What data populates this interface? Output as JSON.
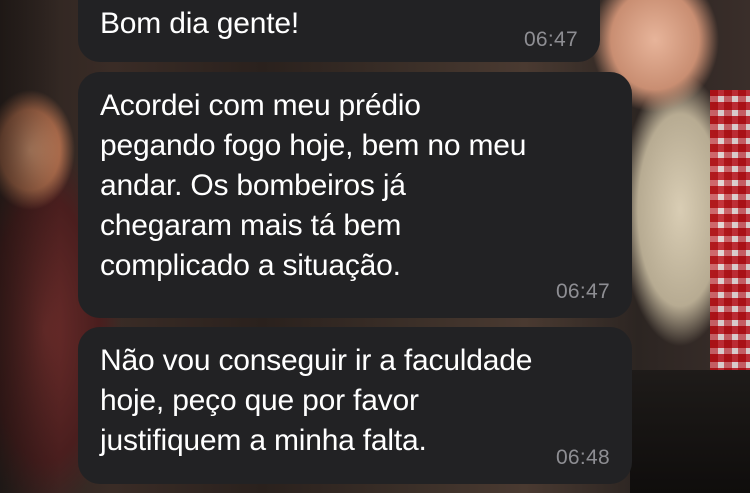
{
  "messages": [
    {
      "text": "Bom dia gente!",
      "time": "06:47"
    },
    {
      "text": "Acordei com meu prédio\npegando fogo hoje, bem no meu\nandar. Os bombeiros já\nchegaram mais tá bem\ncomplicado a situação.",
      "time": "06:47"
    },
    {
      "text": "Não vou conseguir ir a faculdade\nhoje, peço que por favor\njustifiquem a minha falta.",
      "time": "06:48"
    }
  ],
  "colors": {
    "bubble": "#222224",
    "text": "#ffffff",
    "timestamp": "#8e8e93"
  }
}
